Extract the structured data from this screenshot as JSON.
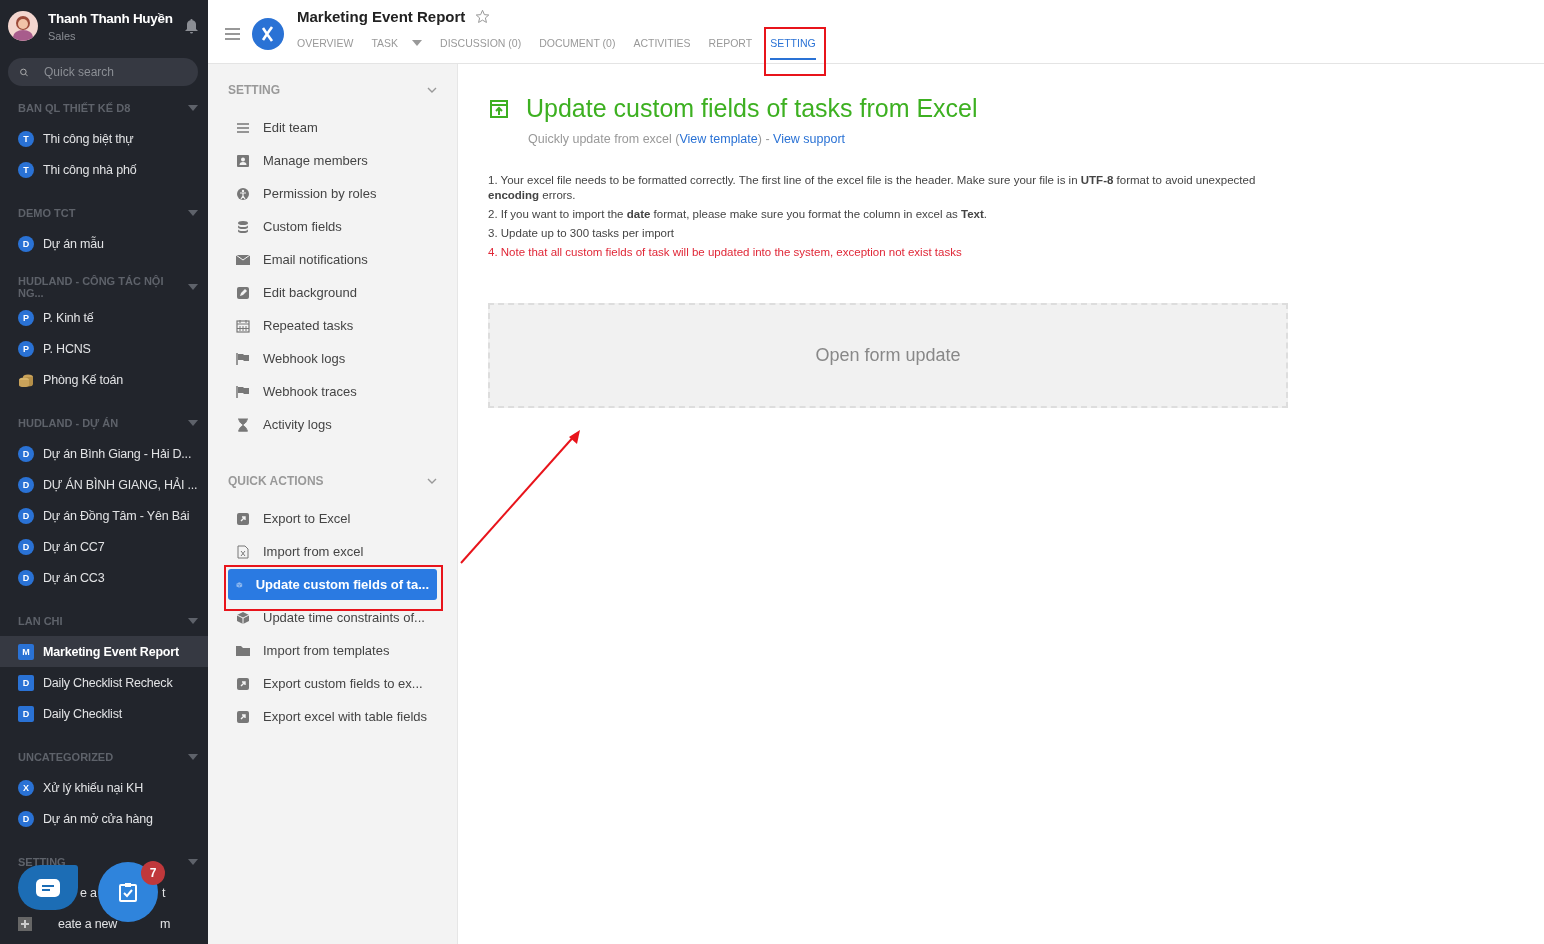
{
  "user": {
    "name": "Thanh Thanh Huyền",
    "role": "Sales"
  },
  "search": {
    "placeholder": "Quick search"
  },
  "sidebar_sections": [
    {
      "title": "BAN QL THIẾT KẾ D8",
      "items": [
        {
          "badge": "T",
          "kind": "circle",
          "label": "Thi công biệt thự",
          "selected": false
        },
        {
          "badge": "T",
          "kind": "circle",
          "label": "Thi công nhà phố",
          "selected": false
        }
      ]
    },
    {
      "title": "DEMO TCT",
      "items": [
        {
          "badge": "D",
          "kind": "circle",
          "label": "Dự án mẫu",
          "selected": false
        }
      ]
    },
    {
      "title": "HUDLAND - CÔNG TÁC NỘI NG...",
      "items": [
        {
          "badge": "P",
          "kind": "circle",
          "label": "P. Kinh tế",
          "selected": false
        },
        {
          "badge": "P",
          "kind": "circle",
          "label": "P. HCNS",
          "selected": false
        },
        {
          "kind": "coins",
          "label": "Phòng Kế toán",
          "selected": false
        }
      ]
    },
    {
      "title": "HUDLAND - DỰ ÁN",
      "items": [
        {
          "badge": "D",
          "kind": "circle",
          "label": "Dự án Bình Giang - Hải D...",
          "selected": false
        },
        {
          "badge": "D",
          "kind": "circle",
          "label": "DỰ ÁN BÌNH GIANG, HẢI ...",
          "selected": false
        },
        {
          "badge": "D",
          "kind": "circle",
          "label": "Dự án Đồng Tâm - Yên Bái",
          "selected": false
        },
        {
          "badge": "D",
          "kind": "circle",
          "label": "Dự án CC7",
          "selected": false
        },
        {
          "badge": "D",
          "kind": "circle",
          "label": "Dự án CC3",
          "selected": false
        }
      ]
    },
    {
      "title": "LAN CHI",
      "items": [
        {
          "badge": "M",
          "kind": "square",
          "label": "Marketing Event Report",
          "selected": true
        },
        {
          "badge": "D",
          "kind": "square",
          "label": "Daily Checklist Recheck",
          "selected": false
        },
        {
          "badge": "D",
          "kind": "square",
          "label": "Daily Checklist",
          "selected": false
        }
      ]
    },
    {
      "title": "UNCATEGORIZED",
      "items": [
        {
          "badge": "X",
          "kind": "circle",
          "label": "Xử lý khiếu nại KH",
          "selected": false
        },
        {
          "badge": "D",
          "kind": "circle",
          "label": "Dự án mở cửa hàng",
          "selected": false
        }
      ]
    },
    {
      "title": "SETTING",
      "items": [
        {
          "kind": "partial",
          "parts": [
            "e a",
            "t"
          ]
        },
        {
          "kind": "partial",
          "parts": [
            "eate a new",
            "m"
          ]
        }
      ]
    }
  ],
  "tasks_button": {
    "count": "7"
  },
  "project": {
    "title": "Marketing Event Report"
  },
  "tabs": [
    {
      "label": "OVERVIEW",
      "selected": false
    },
    {
      "label": "TASK",
      "selected": false,
      "dropdown": true
    },
    {
      "label": "DISCUSSION (0)",
      "selected": false
    },
    {
      "label": "DOCUMENT (0)",
      "selected": false
    },
    {
      "label": "ACTIVITIES",
      "selected": false
    },
    {
      "label": "REPORT",
      "selected": false
    },
    {
      "label": "SETTING",
      "selected": true
    }
  ],
  "settings_groups": [
    {
      "title": "SETTING",
      "items": [
        {
          "label": "Edit team",
          "selected": false
        },
        {
          "label": "Manage members",
          "selected": false
        },
        {
          "label": "Permission by roles",
          "selected": false
        },
        {
          "label": "Custom fields",
          "selected": false
        },
        {
          "label": "Email notifications",
          "selected": false
        },
        {
          "label": "Edit background",
          "selected": false
        },
        {
          "label": "Repeated tasks",
          "selected": false
        },
        {
          "label": "Webhook logs",
          "selected": false
        },
        {
          "label": "Webhook traces",
          "selected": false
        },
        {
          "label": "Activity logs",
          "selected": false
        }
      ]
    },
    {
      "title": "QUICK ACTIONS",
      "items": [
        {
          "label": "Export to Excel",
          "selected": false
        },
        {
          "label": "Import from excel",
          "selected": false
        },
        {
          "label": "Update custom fields of ta...",
          "selected": true
        },
        {
          "label": "Update time constraints of...",
          "selected": false
        },
        {
          "label": "Import from templates",
          "selected": false
        },
        {
          "label": "Export custom fields to ex...",
          "selected": false
        },
        {
          "label": "Export excel with table fields",
          "selected": false
        }
      ]
    }
  ],
  "content": {
    "title": "Update custom fields of tasks from Excel",
    "subtitle": "Quickly update from excel (",
    "template_link": "View template",
    "subtitle_sep": ") - ",
    "support_link": "View support",
    "instructions": [
      {
        "text": "1. Your excel file needs to be formatted correctly. The first line of the excel file is the header. Make sure your file is in **UTF-8** format to avoid unexpected **encoding** errors.",
        "warning": false
      },
      {
        "text": "2. If you want to import the **date** format, please make sure you format the column in excel as **Text**.",
        "warning": false
      },
      {
        "text": "3. Update up to 300 tasks per import",
        "warning": false
      },
      {
        "text": "4. Note that all custom fields of task will be updated into the system, exception not exist tasks",
        "warning": true
      }
    ],
    "open_button": "Open form update"
  }
}
